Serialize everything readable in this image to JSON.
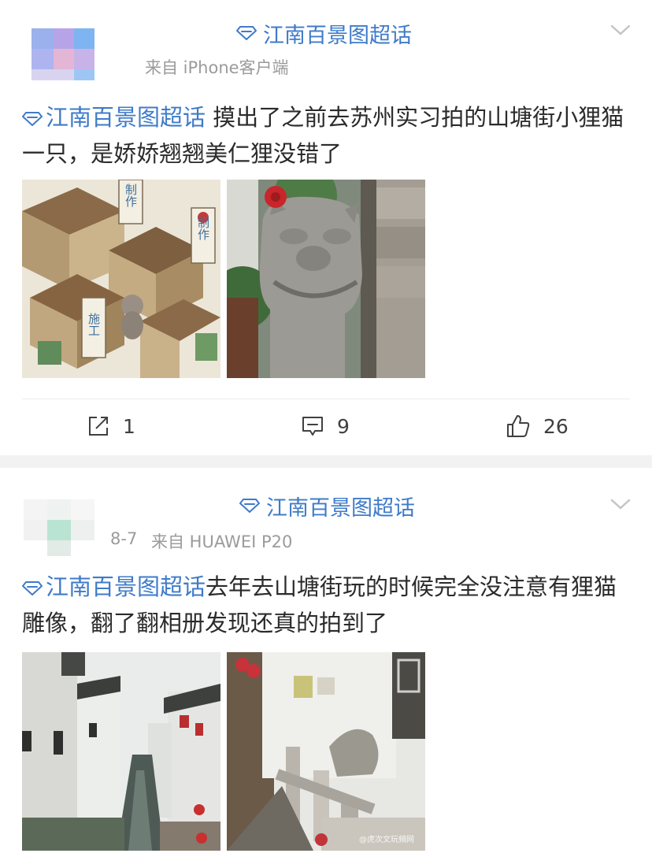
{
  "posts": [
    {
      "topic_header": "江南百景图超话",
      "meta": "来自 iPhone客户端",
      "tag": "江南百景图超话",
      "text": " 摸出了之前去苏州实习拍的山塘街小狸猫一只，是娇娇翘翘美仁狸没错了",
      "images": [
        "game-screenshot-town",
        "stone-raccoon-statue"
      ],
      "game_labels": {
        "sign1": "制作",
        "sign2": "制作",
        "sign3": "施工"
      },
      "actions": {
        "share": "1",
        "comment": "9",
        "like": "26"
      }
    },
    {
      "topic_header": "江南百景图超话",
      "meta_date": "8-7",
      "meta": "来自 HUAWEI P20",
      "tag": "江南百景图超话",
      "text": "去年去山塘街玩的时候完全没注意有狸猫雕像，翻了翻相册发现还真的拍到了",
      "images": [
        "canal-street-photo",
        "statue-on-bridge-photo"
      ],
      "watermark": "@虎次文玩頻网"
    }
  ],
  "colors": {
    "accent": "#3f7bc9",
    "text": "#2b2b2b",
    "meta": "#9b9b9b",
    "separator": "#f2f2f2"
  }
}
